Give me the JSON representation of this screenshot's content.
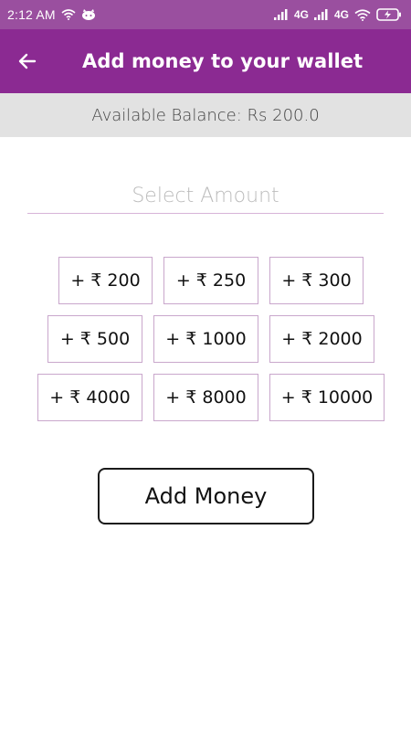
{
  "status_bar": {
    "time": "2:12 AM",
    "network_1": "4G",
    "network_2": "4G"
  },
  "header": {
    "title": "Add money to your wallet"
  },
  "balance": {
    "text": "Available Balance: Rs 200.0"
  },
  "amount_field": {
    "placeholder": "Select Amount",
    "value": ""
  },
  "amount_options": [
    "+ ₹ 200",
    "+ ₹ 250",
    "+ ₹ 300",
    "+ ₹ 500",
    "+ ₹ 1000",
    "+ ₹ 2000",
    "+ ₹ 4000",
    "+ ₹ 8000",
    "+ ₹ 10000"
  ],
  "actions": {
    "add_money_label": "Add Money"
  },
  "colors": {
    "status_bar": "#9a4f9f",
    "app_bar": "#8b2a92",
    "balance_bar": "#e2e2e2",
    "chip_border": "#c9a7cc"
  }
}
